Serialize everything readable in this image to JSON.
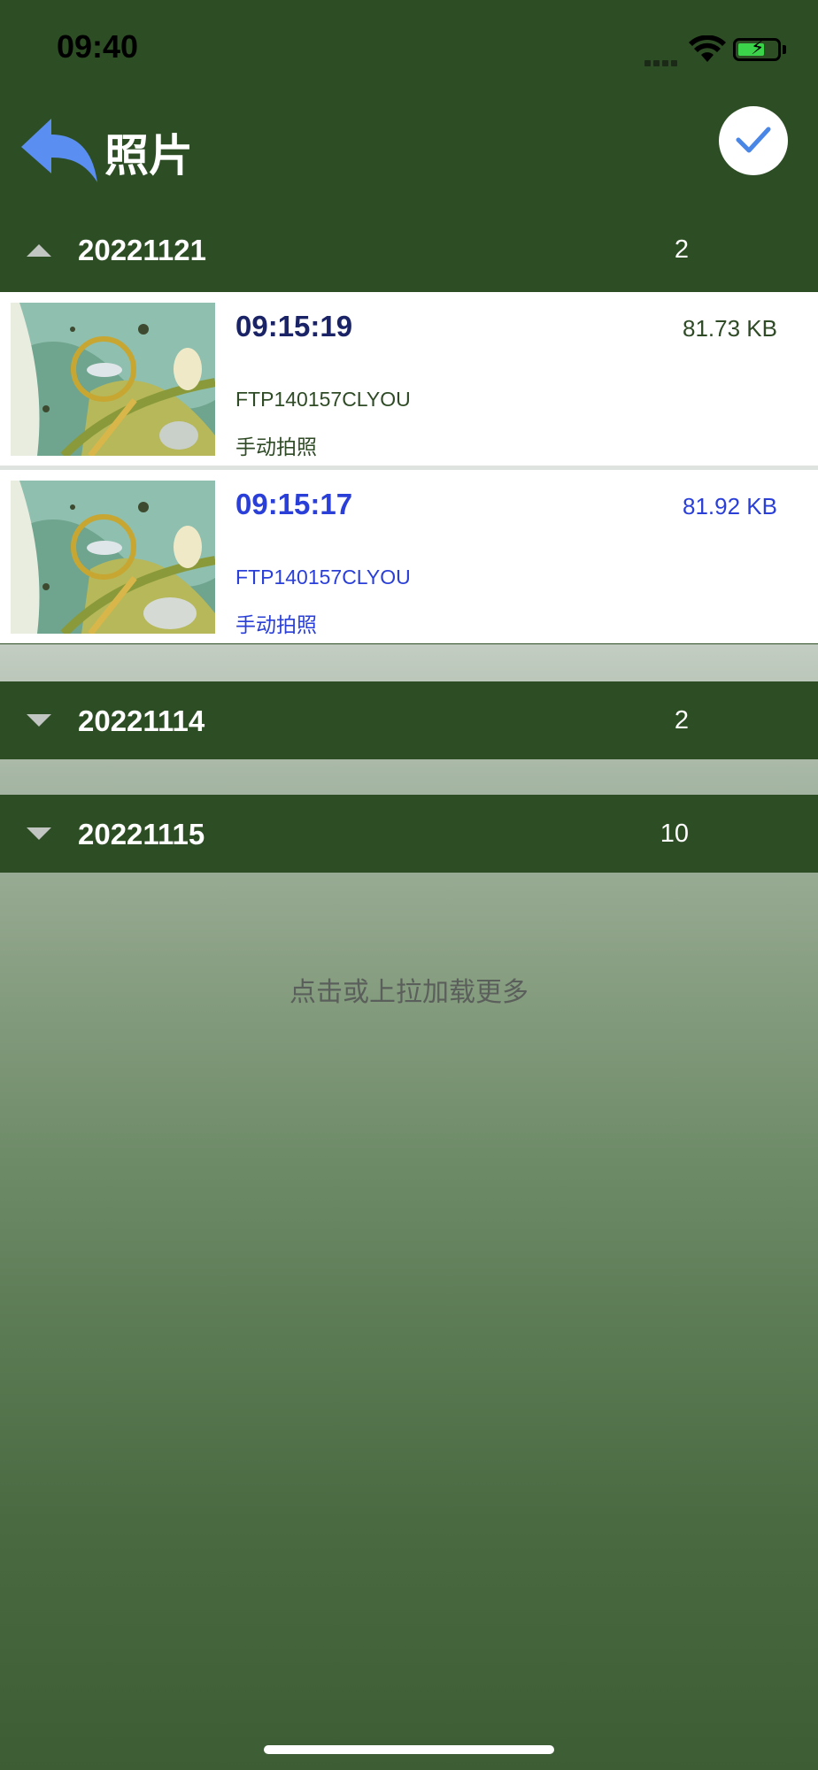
{
  "status_bar": {
    "time": "09:40",
    "signal_icon": "cellular-signal-icon",
    "wifi_icon": "wifi-icon",
    "battery_icon": "battery-charging-icon",
    "battery_level": 0.7
  },
  "nav": {
    "title": "照片",
    "back_icon": "back-arrow-icon",
    "confirm_icon": "checkmark-icon"
  },
  "groups": [
    {
      "date": "20221121",
      "count": "2",
      "expanded": true,
      "photos": [
        {
          "time": "09:15:19",
          "size": "81.73 KB",
          "device": "FTP140157CLYOU",
          "kind": "手动拍照",
          "highlight": false
        },
        {
          "time": "09:15:17",
          "size": "81.92 KB",
          "device": "FTP140157CLYOU",
          "kind": "手动拍照",
          "highlight": true
        }
      ]
    },
    {
      "date": "20221114",
      "count": "2",
      "expanded": false
    },
    {
      "date": "20221115",
      "count": "10",
      "expanded": false
    }
  ],
  "load_more": "点击或上拉加载更多",
  "colors": {
    "header_green": "#2d4d24",
    "time_dark": "#1a2366",
    "text_green": "#2f4b26",
    "highlight_blue": "#2a3fd8",
    "back_arrow_blue": "#5a8ef0"
  }
}
